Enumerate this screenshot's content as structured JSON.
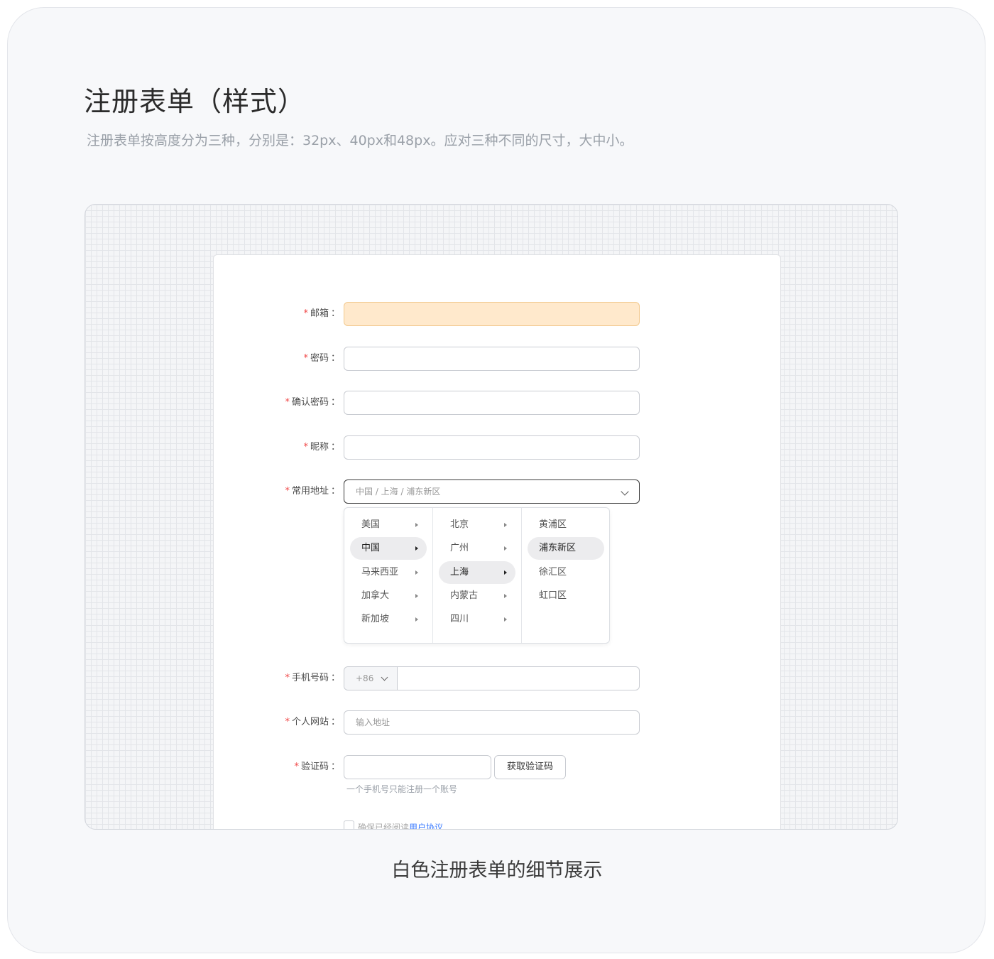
{
  "page": {
    "title": "注册表单（样式）",
    "subtitle": "注册表单按高度分为三种，分别是：32px、40px和48px。应对三种不同的尺寸，大中小。",
    "caption": "白色注册表单的细节展示"
  },
  "form": {
    "required_mark": "*",
    "colon": "：",
    "email": {
      "label": "邮箱",
      "value": ""
    },
    "password": {
      "label": "密码",
      "value": ""
    },
    "confirm_password": {
      "label": "确认密码",
      "value": ""
    },
    "nickname": {
      "label": "昵称",
      "value": ""
    },
    "address": {
      "label": "常用地址",
      "value": "中国 / 上海 / 浦东新区",
      "countries": [
        {
          "label": "美国",
          "active": false
        },
        {
          "label": "中国",
          "active": true
        },
        {
          "label": "马来西亚",
          "active": false
        },
        {
          "label": "加拿大",
          "active": false
        },
        {
          "label": "新加坡",
          "active": false
        }
      ],
      "cities": [
        {
          "label": "北京",
          "active": false
        },
        {
          "label": "广州",
          "active": false
        },
        {
          "label": "上海",
          "active": true
        },
        {
          "label": "内蒙古",
          "active": false
        },
        {
          "label": "四川",
          "active": false
        }
      ],
      "districts": [
        {
          "label": "黄浦区",
          "active": false
        },
        {
          "label": "浦东新区",
          "active": true
        },
        {
          "label": "徐汇区",
          "active": false
        },
        {
          "label": "虹口区",
          "active": false
        }
      ]
    },
    "phone": {
      "label": "手机号码",
      "prefix": "+86",
      "value": ""
    },
    "website": {
      "label": "个人网站",
      "placeholder": "输入地址"
    },
    "captcha": {
      "label": "验证码",
      "button": "获取验证码",
      "hint": "一个手机号只能注册一个账号"
    },
    "agreement": {
      "text": "确保已经阅读",
      "link": "用户协议",
      "checked": false
    }
  },
  "colors": {
    "required": "#f04848",
    "highlight_bg": "#ffe9cc",
    "link": "#3b7bff"
  }
}
